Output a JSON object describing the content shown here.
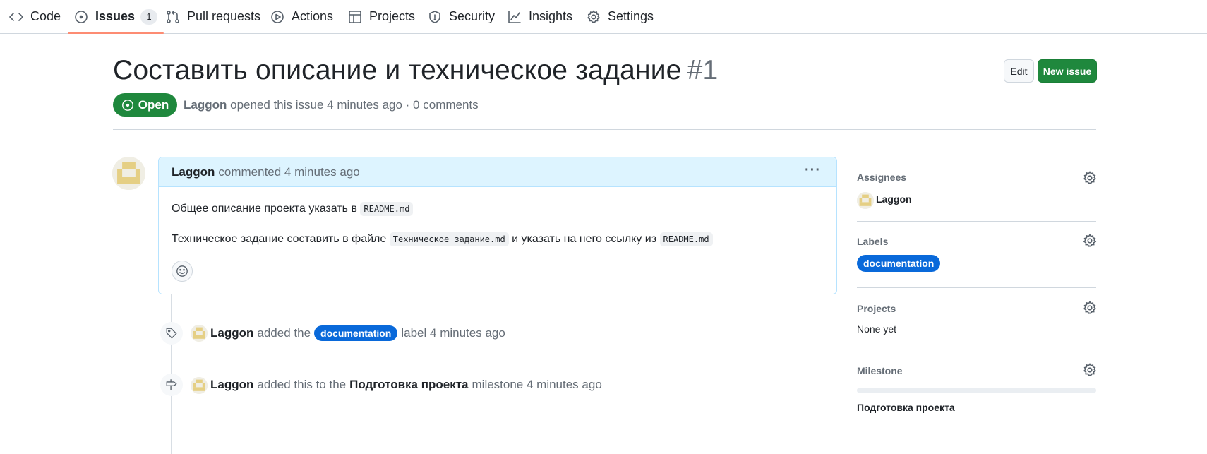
{
  "nav": {
    "items": [
      {
        "label": "Code",
        "icon": "code-icon"
      },
      {
        "label": "Issues",
        "icon": "issue-opened-icon",
        "counter": "1",
        "selected": true
      },
      {
        "label": "Pull requests",
        "icon": "git-pull-request-icon"
      },
      {
        "label": "Actions",
        "icon": "play-icon"
      },
      {
        "label": "Projects",
        "icon": "table-icon"
      },
      {
        "label": "Security",
        "icon": "shield-icon"
      },
      {
        "label": "Insights",
        "icon": "graph-icon"
      },
      {
        "label": "Settings",
        "icon": "gear-icon"
      }
    ],
    "accent_color": "#fd8c73"
  },
  "issue": {
    "title": "Составить описание и техническое задание",
    "number": "#1",
    "edit_label": "Edit",
    "new_issue_label": "New issue",
    "state": "Open",
    "state_color": "#1f883d",
    "author": "Laggon",
    "meta_text": "opened this issue 4 minutes ago · 0 comments"
  },
  "comment": {
    "author": "Laggon",
    "action": "commented 4 minutes ago",
    "line1_text": "Общее описание проекта указать в",
    "line1_code": "README.md",
    "line2_text_a": "Техническое задание составить в файле",
    "line2_code_a": "Техническое задание.md",
    "line2_text_b": "и указать на него ссылку из",
    "line2_code_b": "README.md",
    "header_color": "#ddf4ff"
  },
  "timeline": [
    {
      "icon": "tag-icon",
      "actor": "Laggon",
      "text_before": "added the",
      "label": "documentation",
      "text_after": "label 4 minutes ago"
    },
    {
      "icon": "milestone-icon",
      "actor": "Laggon",
      "text_before": "added this to the",
      "milestone": "Подготовка проекта",
      "text_after": "milestone 4 minutes ago"
    }
  ],
  "sidebar": {
    "assignees": {
      "heading": "Assignees",
      "value": "Laggon"
    },
    "labels": {
      "heading": "Labels",
      "value": "documentation",
      "color": "#0969da"
    },
    "projects": {
      "heading": "Projects",
      "value": "None yet"
    },
    "milestone": {
      "heading": "Milestone",
      "value": "Подготовка проекта",
      "progress_fraction": 0
    }
  }
}
